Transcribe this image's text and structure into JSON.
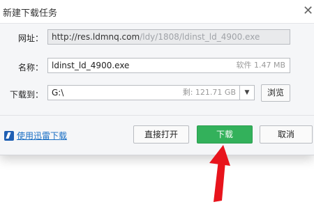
{
  "dialog": {
    "title": "新建下载任务",
    "close_icon": "close-icon"
  },
  "form": {
    "url_label": "网址：",
    "url_host": "http://res.ldmnq.com",
    "url_path": "/ldy/1808/ldinst_ld_4900.exe",
    "name_label": "名称：",
    "name_value": "ldinst_ld_4900.exe",
    "name_hint": "软件 1.47 MB",
    "save_label": "下载到：",
    "save_value": "G:\\",
    "save_hint": "剩: 121.71 GB",
    "browse_label": "浏览"
  },
  "footer": {
    "thunder_label": "使用迅雷下载",
    "open_label": "直接打开",
    "download_label": "下载",
    "cancel_label": "取消"
  },
  "colors": {
    "primary": "#33b15b",
    "arrow": "#e8141c",
    "link": "#1a6fc4"
  }
}
